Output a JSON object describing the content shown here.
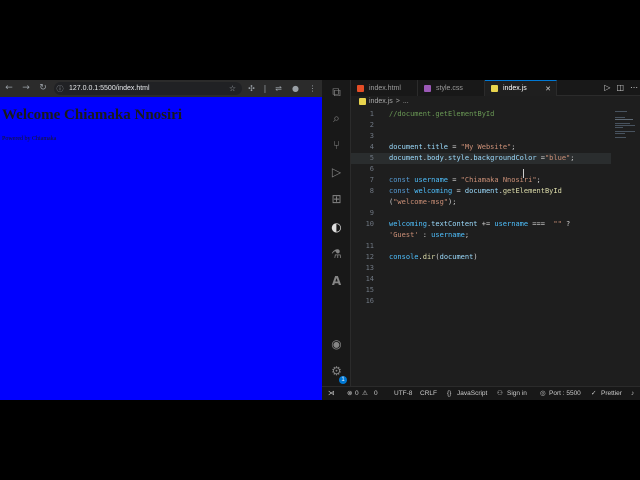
{
  "browser": {
    "url": "127.0.0.1:5500/index.html",
    "page": {
      "heading": "Welcome Chiamaka Nnosiri",
      "subtext": "Powered by Chiamaka"
    }
  },
  "editor": {
    "tabs": [
      {
        "label": "index.html",
        "icon": "html-file-icon",
        "color": "#e44d26"
      },
      {
        "label": "style.css",
        "icon": "css-file-icon",
        "color": "#9b59b6"
      },
      {
        "label": "index.js",
        "icon": "js-file-icon",
        "color": "#e8d44d",
        "active": true
      }
    ],
    "breadcrumb": [
      "index.js",
      ">",
      "..."
    ],
    "lines": [
      {
        "n": "1",
        "tokens": [
          {
            "t": "//document.getElementById",
            "c": "c-comment"
          }
        ]
      },
      {
        "n": "2",
        "tokens": []
      },
      {
        "n": "3",
        "tokens": []
      },
      {
        "n": "4",
        "tokens": [
          {
            "t": "document",
            "c": "c-var"
          },
          {
            "t": ".",
            "c": "c-op"
          },
          {
            "t": "title",
            "c": "c-prop"
          },
          {
            "t": " = ",
            "c": "c-op"
          },
          {
            "t": "\"My Website\"",
            "c": "c-str"
          },
          {
            "t": ";",
            "c": "c-op"
          }
        ]
      },
      {
        "n": "5",
        "tokens": [
          {
            "t": "document",
            "c": "c-var"
          },
          {
            "t": ".",
            "c": "c-op"
          },
          {
            "t": "body",
            "c": "c-prop"
          },
          {
            "t": ".",
            "c": "c-op"
          },
          {
            "t": "style",
            "c": "c-prop"
          },
          {
            "t": ".",
            "c": "c-op"
          },
          {
            "t": "backgroundColor",
            "c": "c-prop"
          },
          {
            "t": " =",
            "c": "c-op"
          },
          {
            "t": "\"blue\"",
            "c": "c-str"
          },
          {
            "t": ";",
            "c": "c-op"
          }
        ],
        "highlight": true
      },
      {
        "n": "6",
        "tokens": []
      },
      {
        "n": "7",
        "tokens": [
          {
            "t": "const ",
            "c": "c-kw"
          },
          {
            "t": "username",
            "c": "c-const"
          },
          {
            "t": " = ",
            "c": "c-op"
          },
          {
            "t": "\"Chiamaka Nnosiri\"",
            "c": "c-str"
          },
          {
            "t": ";",
            "c": "c-op"
          }
        ]
      },
      {
        "n": "8",
        "tokens": [
          {
            "t": "const ",
            "c": "c-kw"
          },
          {
            "t": "welcoming",
            "c": "c-const"
          },
          {
            "t": " = ",
            "c": "c-op"
          },
          {
            "t": "document",
            "c": "c-var"
          },
          {
            "t": ".",
            "c": "c-op"
          },
          {
            "t": "getElementById",
            "c": "c-fn"
          }
        ]
      },
      {
        "n": "",
        "tokens": [
          {
            "t": "(",
            "c": "c-op"
          },
          {
            "t": "\"welcome-msg\"",
            "c": "c-str"
          },
          {
            "t": ");",
            "c": "c-op"
          }
        ]
      },
      {
        "n": "9",
        "tokens": []
      },
      {
        "n": "10",
        "tokens": [
          {
            "t": "welcoming",
            "c": "c-const"
          },
          {
            "t": ".",
            "c": "c-op"
          },
          {
            "t": "textContent",
            "c": "c-prop"
          },
          {
            "t": " += ",
            "c": "c-op"
          },
          {
            "t": "username",
            "c": "c-const"
          },
          {
            "t": " ===  ",
            "c": "c-op"
          },
          {
            "t": "\"\"",
            "c": "c-str"
          },
          {
            "t": " ?",
            "c": "c-op"
          }
        ]
      },
      {
        "n": "",
        "tokens": [
          {
            "t": "'Guest'",
            "c": "c-str"
          },
          {
            "t": " : ",
            "c": "c-op"
          },
          {
            "t": "username",
            "c": "c-const"
          },
          {
            "t": ";",
            "c": "c-op"
          }
        ]
      },
      {
        "n": "11",
        "tokens": []
      },
      {
        "n": "12",
        "tokens": [
          {
            "t": "console",
            "c": "c-const"
          },
          {
            "t": ".",
            "c": "c-op"
          },
          {
            "t": "dir",
            "c": "c-fn"
          },
          {
            "t": "(",
            "c": "c-op"
          },
          {
            "t": "document",
            "c": "c-var"
          },
          {
            "t": ")",
            "c": "c-op"
          }
        ]
      },
      {
        "n": "13",
        "tokens": []
      },
      {
        "n": "14",
        "tokens": []
      },
      {
        "n": "15",
        "tokens": []
      },
      {
        "n": "16",
        "tokens": []
      }
    ]
  },
  "activity_bar": {
    "icons": [
      "explorer-icon",
      "search-icon",
      "source-control-icon",
      "run-debug-icon",
      "extensions-icon",
      "edge-devtools-icon",
      "testing-icon",
      "azure-icon",
      "accounts-icon",
      "manage-gear-icon"
    ],
    "badge": "1"
  },
  "statusbar": {
    "errors": "0",
    "warnings": "0",
    "encoding": "UTF-8",
    "eol": "CRLF",
    "language": "JavaScript",
    "sign_in": "Sign in",
    "port": "Port : 5500",
    "prettier": "Prettier"
  },
  "colors": {
    "page_background": "#0000ff",
    "editor_background": "#1e1e1e",
    "accent": "#0078d4"
  }
}
